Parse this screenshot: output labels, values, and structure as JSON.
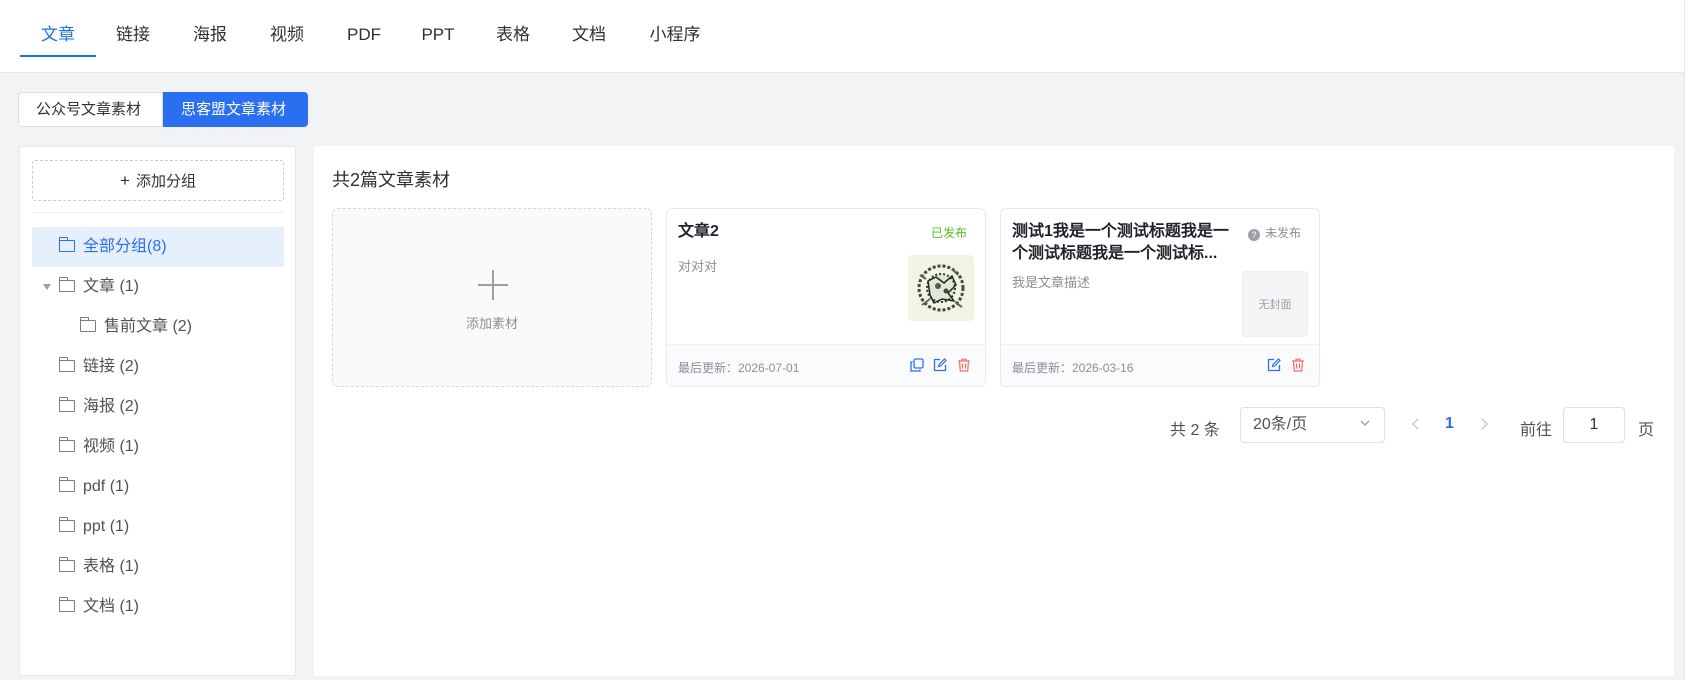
{
  "top_tabs": [
    "文章",
    "链接",
    "海报",
    "视频",
    "PDF",
    "PPT",
    "表格",
    "文档",
    "小程序"
  ],
  "active_tab": "文章",
  "source_segments": {
    "left": "公众号文章素材",
    "right": "思客盟文章素材"
  },
  "sidebar": {
    "add_group_label": "添加分组",
    "tree": [
      {
        "label": "全部分组(8)",
        "selected": true
      },
      {
        "label": "文章 (1)",
        "expanded": true
      },
      {
        "label": "售前文章 (2)",
        "child": true
      },
      {
        "label": "链接 (2)"
      },
      {
        "label": "海报 (2)"
      },
      {
        "label": "视频 (1)"
      },
      {
        "label": "pdf (1)"
      },
      {
        "label": "ppt (1)"
      },
      {
        "label": "表格 (1)"
      },
      {
        "label": "文档 (1)"
      }
    ]
  },
  "main": {
    "title": "共2篇文章素材",
    "add_card_label": "添加素材",
    "cards": [
      {
        "title": "文章2",
        "status": "已发布",
        "description": "对对对",
        "updated": "最后更新：2026-07-01",
        "cover": "image"
      },
      {
        "title": "测试1我是一个测试标题我是一个测试标题我是一个测试标...",
        "status": "未发布",
        "description": "我是文章描述",
        "updated": "最后更新：2026-03-16",
        "cover_label": "无封面"
      }
    ]
  },
  "pagination": {
    "total": "共 2 条",
    "page_size": "20条/页",
    "current_page": "1",
    "goto_label": "前往",
    "goto_value": "1",
    "goto_suffix": "页"
  },
  "colors": {
    "accent": "#2a6ff0",
    "published": "#52c41a",
    "delete": "#f56c6c"
  }
}
